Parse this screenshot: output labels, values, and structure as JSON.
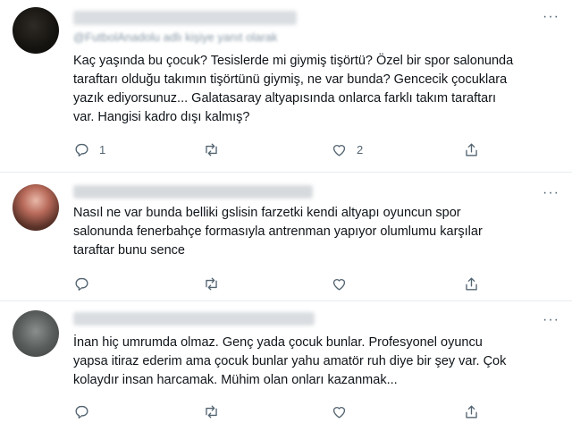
{
  "tweets": [
    {
      "reply_to": "@FutbolAnadolu adlı kişiye yanıt olarak",
      "text": "Kaç yaşında bu çocuk? Tesislerde mi giymiş tişörtü? Özel bir spor salonunda\ntaraftarı olduğu takımın tişörtünü giymiş, ne var bunda? Gencecik çocuklara\nyazık ediyorsunuz... Galatasaray altyapısında onlarca farklı takım taraftarı\nvar. Hangisi kadro dışı kalmış?",
      "reply_count": "1",
      "retweet_count": "",
      "like_count": "2",
      "share_count": ""
    },
    {
      "text": "Nasıl ne var bunda belliki gslisin farzetki kendi altyapı oyuncun spor\nsalonunda fenerbahçe formasıyla antrenman yapıyor olumlumu karşılar\ntaraftar bunu sence",
      "reply_count": "",
      "retweet_count": "",
      "like_count": "",
      "share_count": ""
    },
    {
      "text": "İnan hiç umrumda olmaz. Genç yada çocuk bunlar. Profesyonel oyuncu\nyapsa itiraz ederim ama çocuk bunlar yahu amatör ruh diye bir şey var. Çok\nkolaydır insan harcamak. Mühim olan onları kazanmak...",
      "reply_count": "",
      "retweet_count": "",
      "like_count": "",
      "share_count": ""
    }
  ],
  "icons": {
    "more": "more-icon",
    "reply": "reply-icon",
    "retweet": "retweet-icon",
    "like": "like-icon",
    "share": "share-icon"
  },
  "colors": {
    "text": "#0f1419",
    "secondary": "#536471",
    "divider": "#e6ecf0"
  }
}
